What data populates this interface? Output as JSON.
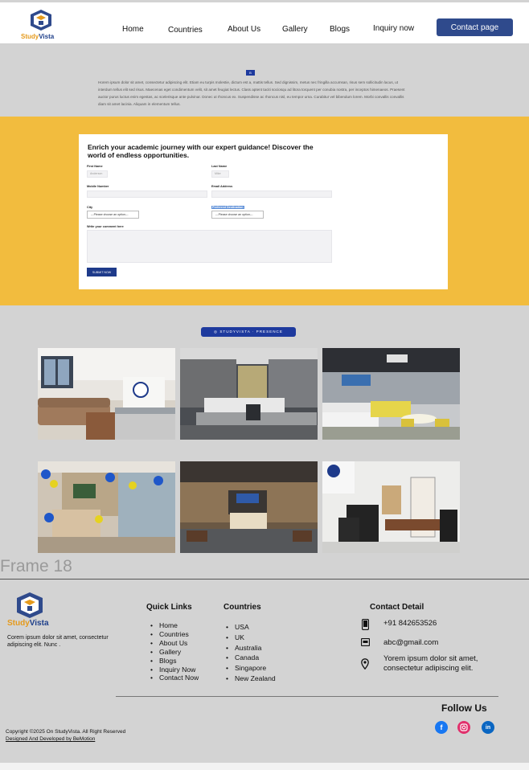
{
  "brand": {
    "logo_text_a": "Study",
    "logo_text_b": "Vista"
  },
  "nav": {
    "items": [
      "Home",
      "Countries",
      "About Us",
      "Gallery",
      "Blogs",
      "Inquiry now"
    ],
    "contact_button": "Contact page"
  },
  "intro": {
    "badge": "B",
    "text": "Horem ipsum dolor sit amet, consectetur adipiscing elit. Etiam eu turpis molestie, dictum est a, mattis tellus. Sed dignissim, metus nec fringilla accumsan, risus sem sollicitudin lacus, ut interdum tellus elit sed risus. Maecenas eget condimentum velit, sit amet feugiat lectus. Class aptent taciti sociosqu ad litora torquent per conubia nostra, per inceptos himenaeos. Praesent auctor purus luctus enim egestas, ac scelerisque ante pulvinar. Donec ut rhoncus ex. Suspendisse ac rhoncus nisl, eu tempor urna. Curabitur vel bibendum lorem. Morbi convallis convallis diam sit amet lacinia. Aliquam in elementum tellus."
  },
  "form": {
    "title": "Enrich your academic journey with our expert guidance! Discover the world of endless opportunities.",
    "first_name_label": "First Name",
    "first_name_placeholder": "Anderson",
    "last_name_label": "Last Name",
    "last_name_placeholder": "Mike",
    "mobile_label": "Mobile Number",
    "email_label": "Email Address",
    "city_label": "City",
    "city_select": "---Please choose an option---",
    "preferred_label": "Preferred Destination",
    "preferred_select": "---Please choose an option---",
    "comment_label": "Write your comment here",
    "submit": "SUBMIT NOW"
  },
  "gallery": {
    "badge": "◎ STUDYVISTA · PRESENCE",
    "frame_label": "Frame 18"
  },
  "footer": {
    "about": "Corem ipsum dolor sit amet, consectetur adipiscing elit. Nunc .",
    "quick_links_title": "Quick Links",
    "quick_links": [
      "Home",
      "Countries",
      "About Us",
      "Gallery",
      "Blogs",
      "Inquiry Now",
      "Contact Now"
    ],
    "countries_title": "Countries",
    "countries": [
      "USA",
      "UK",
      "Australia",
      "Canada",
      "Singapore",
      "New Zealand"
    ],
    "contact_title": "Contact Detail",
    "phone": "+91 842653526",
    "email": "abc@gmail.com",
    "address": "Yorem ipsum dolor sit amet, consectetur adipiscing elit.",
    "follow_title": "Follow Us",
    "copyright": "Copyright ©2025 On StudyVista. All Right Reserved",
    "developed_prefix": "Designed And Developed by ",
    "developed_by": "BeMotion"
  },
  "icons": {
    "phone": "phone-icon",
    "mail": "mail-icon",
    "location": "location-pin-icon",
    "facebook": "facebook-icon",
    "instagram": "instagram-icon",
    "linkedin": "linkedin-icon"
  },
  "colors": {
    "brand_blue": "#2f4a8c",
    "brand_orange": "#e59a1c",
    "form_band": "#f2bc3e",
    "facebook": "#1877f2",
    "instagram": "#e1306c",
    "linkedin": "#0a66c2"
  }
}
